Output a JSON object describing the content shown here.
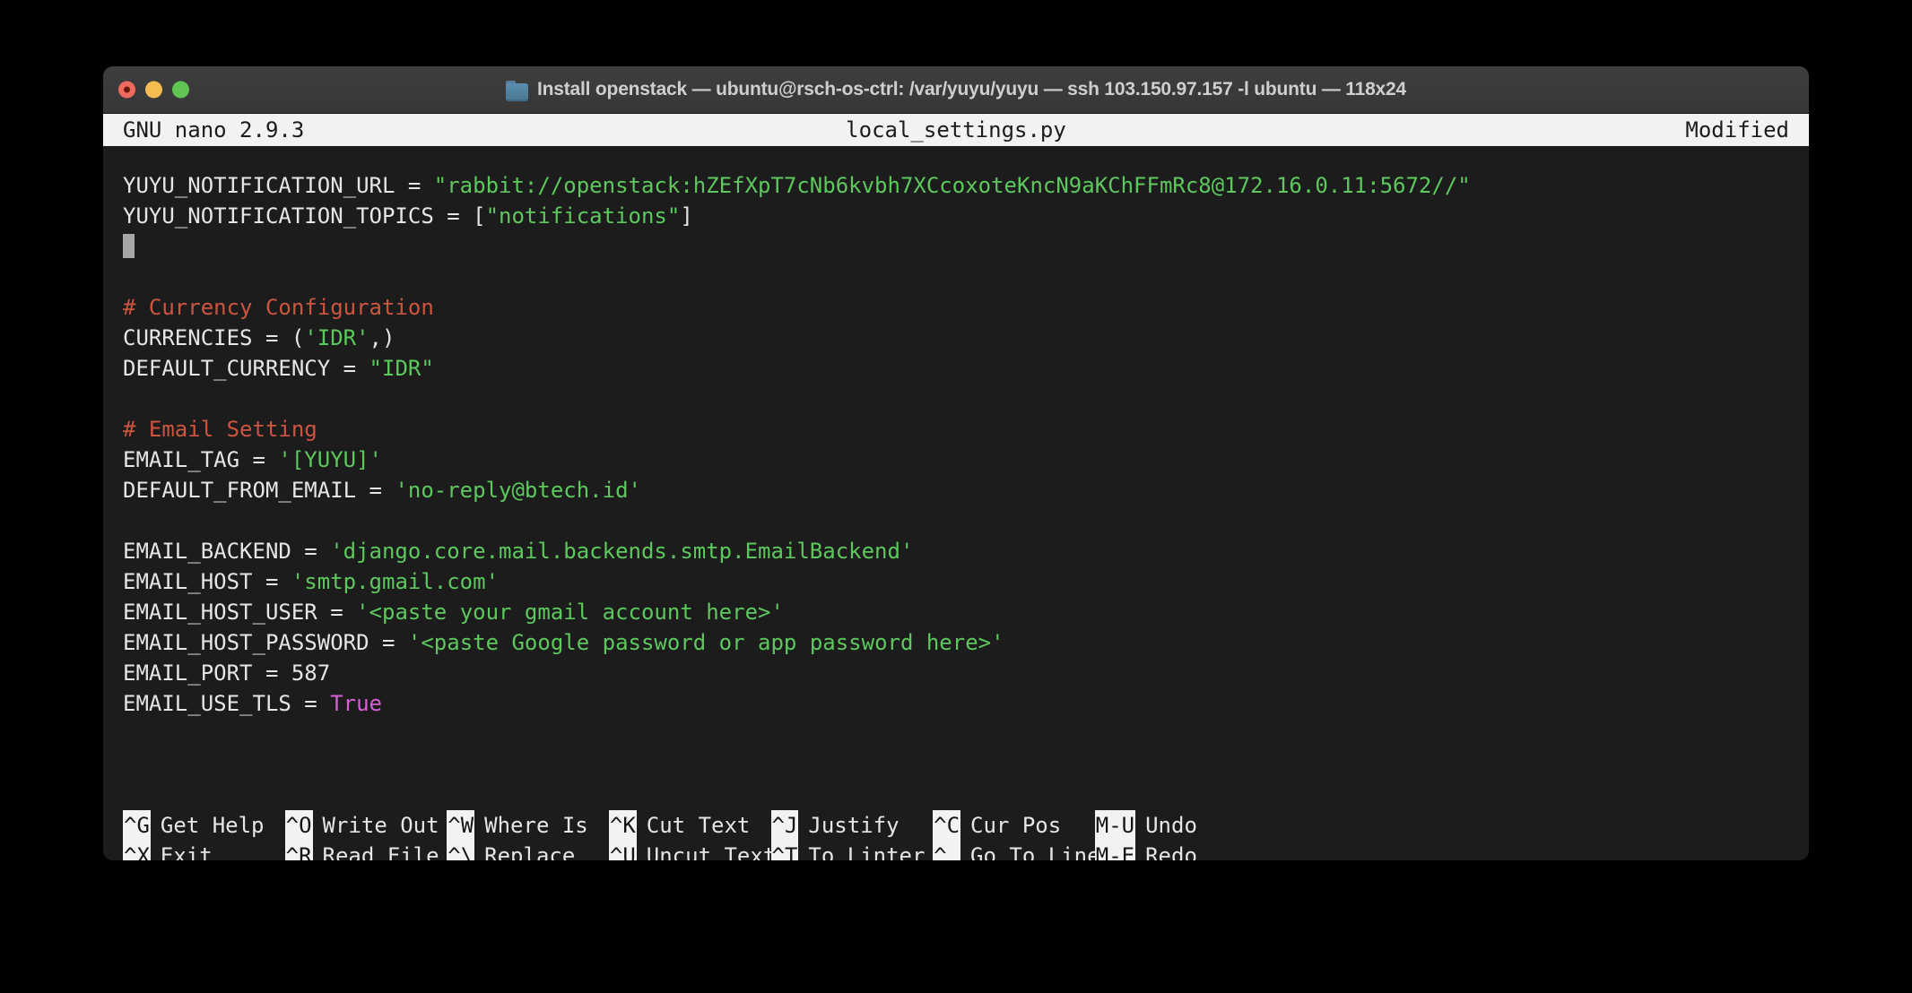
{
  "window": {
    "title": "Install openstack — ubuntu@rsch-os-ctrl: /var/yuyu/yuyu — ssh 103.150.97.157 -l ubuntu — 118x24",
    "folder_icon": "folder-icon",
    "traffic_lights": [
      {
        "name": "close-button",
        "color": "#ee6a5f"
      },
      {
        "name": "minimize-button",
        "color": "#f5bd4f"
      },
      {
        "name": "maximize-button",
        "color": "#61c554"
      }
    ],
    "background": "#1c1c1c"
  },
  "nano": {
    "version": "GNU nano 2.9.3",
    "filename": "local_settings.py",
    "status": "Modified",
    "colors": {
      "string": "#5dc85d",
      "comment": "#cd5540",
      "keyword": "#d65fd6",
      "text": "#e6e6e6",
      "cursor": "#a6a6a6",
      "bar_bg": "#f2f2f2"
    }
  },
  "editor": {
    "lines": [
      {
        "id": "line-1",
        "segments": [
          {
            "t": "YUYU_NOTIFICATION_URL = ",
            "c": "plain"
          },
          {
            "t": "\"rabbit://openstack:hZEfXpT7cNb6kvbh7XCcoxoteKncN9aKChFFmRc8@172.16.0.11:5672//\"",
            "c": "str"
          }
        ]
      },
      {
        "id": "line-2",
        "segments": [
          {
            "t": "YUYU_NOTIFICATION_TOPICS = [",
            "c": "plain"
          },
          {
            "t": "\"notifications\"",
            "c": "str"
          },
          {
            "t": "]",
            "c": "plain"
          }
        ]
      },
      {
        "id": "line-3-cursor",
        "segments": [],
        "cursor": true
      },
      {
        "id": "line-4",
        "segments": []
      },
      {
        "id": "line-5",
        "segments": [
          {
            "t": "# Currency Configuration",
            "c": "comment"
          }
        ]
      },
      {
        "id": "line-6",
        "segments": [
          {
            "t": "CURRENCIES = (",
            "c": "plain"
          },
          {
            "t": "'IDR'",
            "c": "str"
          },
          {
            "t": ",)",
            "c": "plain"
          }
        ]
      },
      {
        "id": "line-7",
        "segments": [
          {
            "t": "DEFAULT_CURRENCY = ",
            "c": "plain"
          },
          {
            "t": "\"IDR\"",
            "c": "str"
          }
        ]
      },
      {
        "id": "line-8",
        "segments": []
      },
      {
        "id": "line-9",
        "segments": [
          {
            "t": "# Email Setting",
            "c": "comment"
          }
        ]
      },
      {
        "id": "line-10",
        "segments": [
          {
            "t": "EMAIL_TAG = ",
            "c": "plain"
          },
          {
            "t": "'[YUYU]'",
            "c": "str"
          }
        ]
      },
      {
        "id": "line-11",
        "segments": [
          {
            "t": "DEFAULT_FROM_EMAIL = ",
            "c": "plain"
          },
          {
            "t": "'no-reply@btech.id'",
            "c": "str"
          }
        ]
      },
      {
        "id": "line-12",
        "segments": []
      },
      {
        "id": "line-13",
        "segments": [
          {
            "t": "EMAIL_BACKEND = ",
            "c": "plain"
          },
          {
            "t": "'django.core.mail.backends.smtp.EmailBackend'",
            "c": "str"
          }
        ]
      },
      {
        "id": "line-14",
        "segments": [
          {
            "t": "EMAIL_HOST = ",
            "c": "plain"
          },
          {
            "t": "'smtp.gmail.com'",
            "c": "str"
          }
        ]
      },
      {
        "id": "line-15",
        "segments": [
          {
            "t": "EMAIL_HOST_USER = ",
            "c": "plain"
          },
          {
            "t": "'<paste your gmail account here>'",
            "c": "str"
          }
        ]
      },
      {
        "id": "line-16",
        "segments": [
          {
            "t": "EMAIL_HOST_PASSWORD = ",
            "c": "plain"
          },
          {
            "t": "'<paste Google password or app password here>'",
            "c": "str"
          }
        ]
      },
      {
        "id": "line-17",
        "segments": [
          {
            "t": "EMAIL_PORT = 587",
            "c": "plain"
          }
        ]
      },
      {
        "id": "line-18",
        "segments": [
          {
            "t": "EMAIL_USE_TLS = ",
            "c": "plain"
          },
          {
            "t": "True",
            "c": "kw"
          }
        ]
      },
      {
        "id": "line-19",
        "segments": []
      },
      {
        "id": "line-20",
        "segments": []
      },
      {
        "id": "line-21",
        "segments": []
      }
    ]
  },
  "shortcuts": {
    "row1": [
      {
        "key": "^G",
        "label": "Get Help",
        "name": "shortcut-get-help"
      },
      {
        "key": "^O",
        "label": "Write Out",
        "name": "shortcut-write-out"
      },
      {
        "key": "^W",
        "label": "Where Is",
        "name": "shortcut-where-is"
      },
      {
        "key": "^K",
        "label": "Cut Text",
        "name": "shortcut-cut-text"
      },
      {
        "key": "^J",
        "label": "Justify",
        "name": "shortcut-justify"
      },
      {
        "key": "^C",
        "label": "Cur Pos",
        "name": "shortcut-cur-pos"
      },
      {
        "key": "M-U",
        "label": "Undo",
        "name": "shortcut-undo"
      }
    ],
    "row2": [
      {
        "key": "^X",
        "label": "Exit",
        "name": "shortcut-exit"
      },
      {
        "key": "^R",
        "label": "Read File",
        "name": "shortcut-read-file"
      },
      {
        "key": "^\\",
        "label": "Replace",
        "name": "shortcut-replace"
      },
      {
        "key": "^U",
        "label": "Uncut Text",
        "name": "shortcut-uncut-text"
      },
      {
        "key": "^T",
        "label": "To Linter",
        "name": "shortcut-to-linter"
      },
      {
        "key": "^_",
        "label": "Go To Line",
        "name": "shortcut-go-to-line"
      },
      {
        "key": "M-E",
        "label": "Redo",
        "name": "shortcut-redo"
      }
    ]
  }
}
